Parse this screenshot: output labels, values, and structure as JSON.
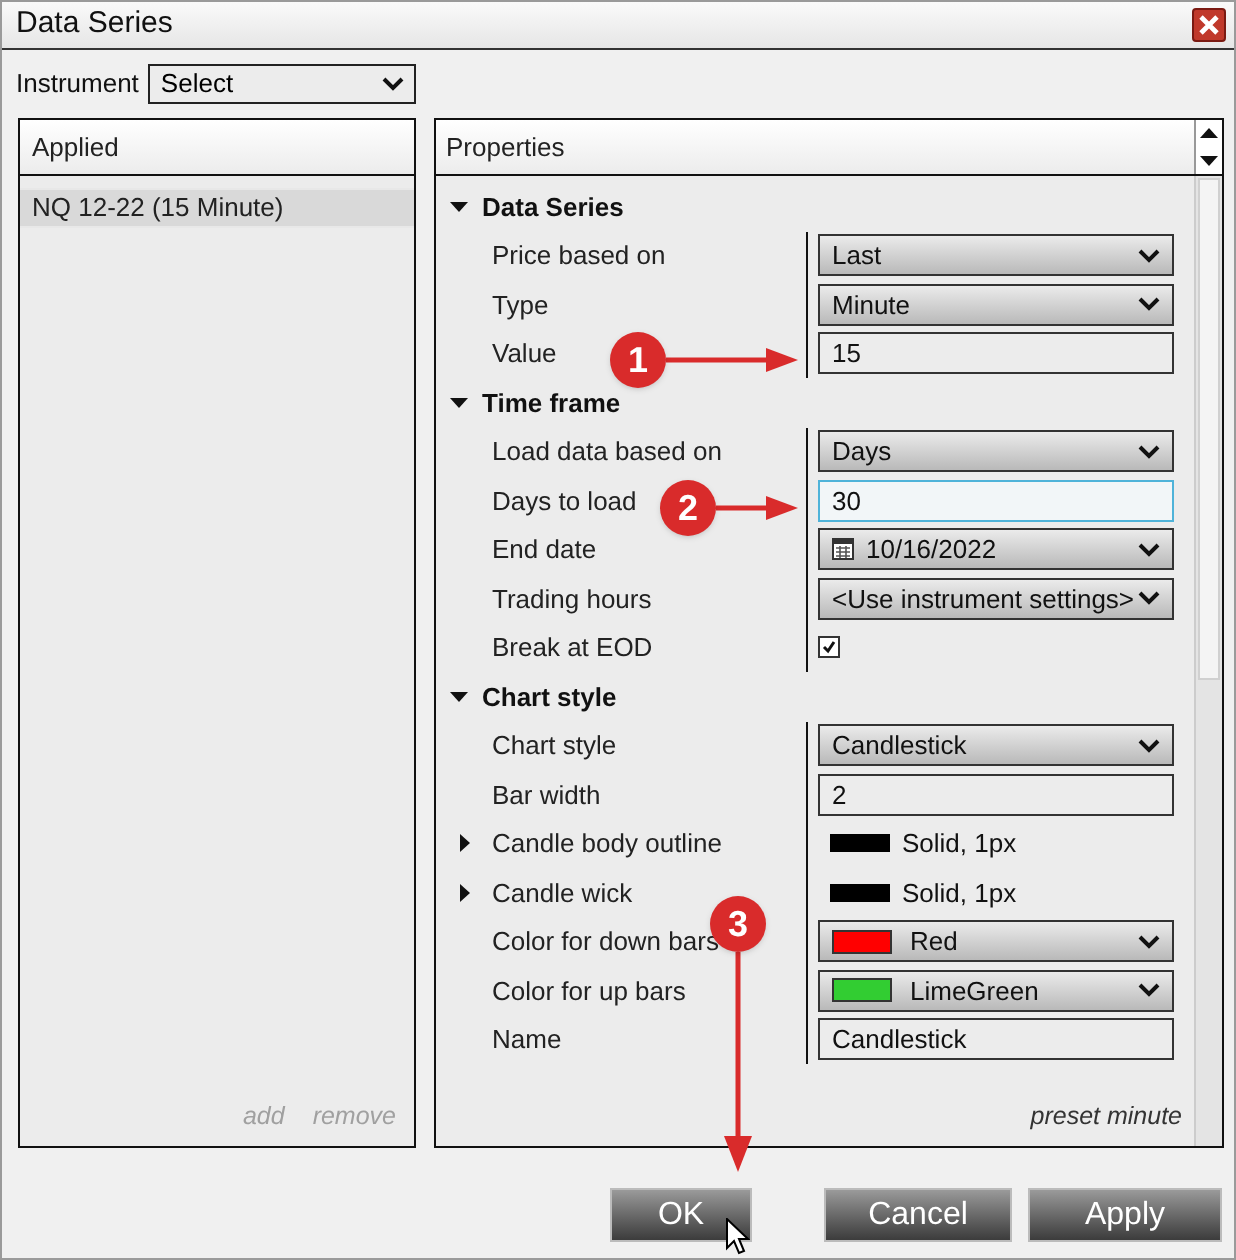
{
  "window": {
    "title": "Data Series"
  },
  "instrument": {
    "label": "Instrument",
    "value": "Select"
  },
  "applied": {
    "title": "Applied",
    "items": [
      {
        "label": "NQ 12-22 (15 Minute)",
        "selected": true
      }
    ],
    "actions": [
      "add",
      "remove"
    ]
  },
  "properties": {
    "title": "Properties",
    "sections": [
      {
        "title": "Data Series",
        "expanded": true,
        "rows": [
          {
            "label": "Price based on",
            "kind": "select",
            "value": "Last"
          },
          {
            "label": "Type",
            "kind": "select",
            "value": "Minute"
          },
          {
            "label": "Value",
            "kind": "text",
            "value": "15",
            "focused": false
          }
        ]
      },
      {
        "title": "Time frame",
        "expanded": true,
        "rows": [
          {
            "label": "Load data based on",
            "kind": "select",
            "value": "Days"
          },
          {
            "label": "Days to load",
            "kind": "text",
            "value": "30",
            "focused": true
          },
          {
            "label": "End date",
            "kind": "date",
            "value": "10/16/2022"
          },
          {
            "label": "Trading hours",
            "kind": "select",
            "value": "<Use instrument settings>"
          },
          {
            "label": "Break at EOD",
            "kind": "checkbox",
            "checked": true
          }
        ]
      },
      {
        "title": "Chart style",
        "expanded": true,
        "rows": [
          {
            "label": "Chart style",
            "kind": "select",
            "value": "Candlestick"
          },
          {
            "label": "Bar width",
            "kind": "text",
            "value": "2",
            "focused": false
          },
          {
            "label": "Candle body outline",
            "kind": "stroke",
            "expanded": false,
            "value": "Solid, 1px",
            "color": "#000000"
          },
          {
            "label": "Candle wick",
            "kind": "stroke",
            "expanded": false,
            "value": "Solid, 1px",
            "color": "#000000"
          },
          {
            "label": "Color for down bars",
            "kind": "color",
            "value": "Red",
            "color": "#ff0000"
          },
          {
            "label": "Color for up bars",
            "kind": "color",
            "value": "LimeGreen",
            "color": "#32cd32"
          },
          {
            "label": "Name",
            "kind": "text",
            "value": "Candlestick",
            "focused": false
          }
        ]
      }
    ],
    "footer": "preset minute"
  },
  "buttons": [
    "OK",
    "Cancel",
    "Apply"
  ],
  "callouts": [
    {
      "label": "1",
      "kind": "right"
    },
    {
      "label": "2",
      "kind": "right"
    },
    {
      "label": "3",
      "kind": "down"
    }
  ]
}
